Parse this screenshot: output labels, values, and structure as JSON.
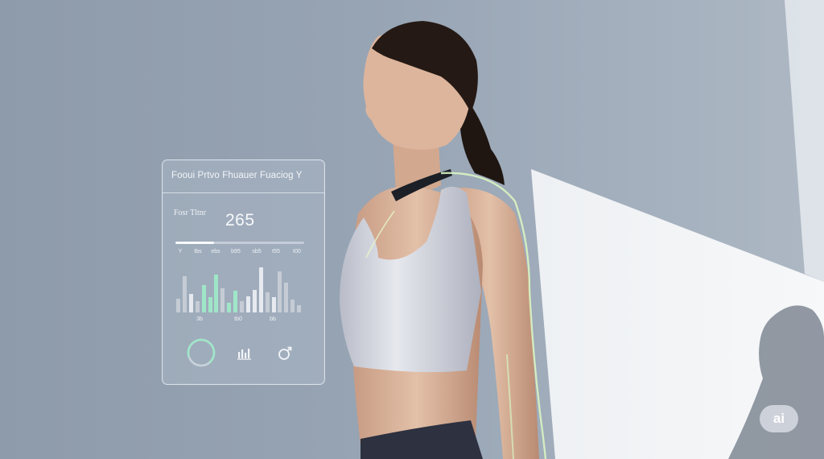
{
  "panel": {
    "title": "Fooui Prtvo Fhuauer Fuaciog  Y",
    "stat_label": "Fosr Tltnr",
    "stat_value": "265",
    "progress": 0.3,
    "ticks": [
      "Y",
      "tbs",
      "ebs",
      "b95",
      "sb5",
      "t55",
      "t00"
    ],
    "xlabels": [
      "3b",
      "tb0",
      "bb"
    ],
    "bars": [
      {
        "v": 0.22,
        "tone": "gray"
      },
      {
        "v": 0.58,
        "tone": "gray"
      },
      {
        "v": 0.3,
        "tone": "light"
      },
      {
        "v": 0.18,
        "tone": "gray"
      },
      {
        "v": 0.44,
        "tone": "mint"
      },
      {
        "v": 0.24,
        "tone": "mint"
      },
      {
        "v": 0.6,
        "tone": "mint"
      },
      {
        "v": 0.38,
        "tone": "gray"
      },
      {
        "v": 0.16,
        "tone": "mint"
      },
      {
        "v": 0.34,
        "tone": "mint"
      },
      {
        "v": 0.18,
        "tone": "gray"
      },
      {
        "v": 0.26,
        "tone": "light"
      },
      {
        "v": 0.36,
        "tone": "light"
      },
      {
        "v": 0.72,
        "tone": "light"
      },
      {
        "v": 0.32,
        "tone": "gray"
      },
      {
        "v": 0.24,
        "tone": "light"
      },
      {
        "v": 0.66,
        "tone": "gray"
      },
      {
        "v": 0.48,
        "tone": "gray"
      },
      {
        "v": 0.2,
        "tone": "gray"
      },
      {
        "v": 0.12,
        "tone": "gray"
      }
    ],
    "icons": [
      "progress-ring-icon",
      "bar-chart-icon",
      "gender-symbol-icon"
    ]
  },
  "badge": {
    "label": "ai"
  },
  "colors": {
    "background": "#97a4b4",
    "mint": "#9fe6c8",
    "bar_gray": "#c5ccd5",
    "bar_light": "#e6eaf0",
    "contour": "#d8f3c2"
  }
}
